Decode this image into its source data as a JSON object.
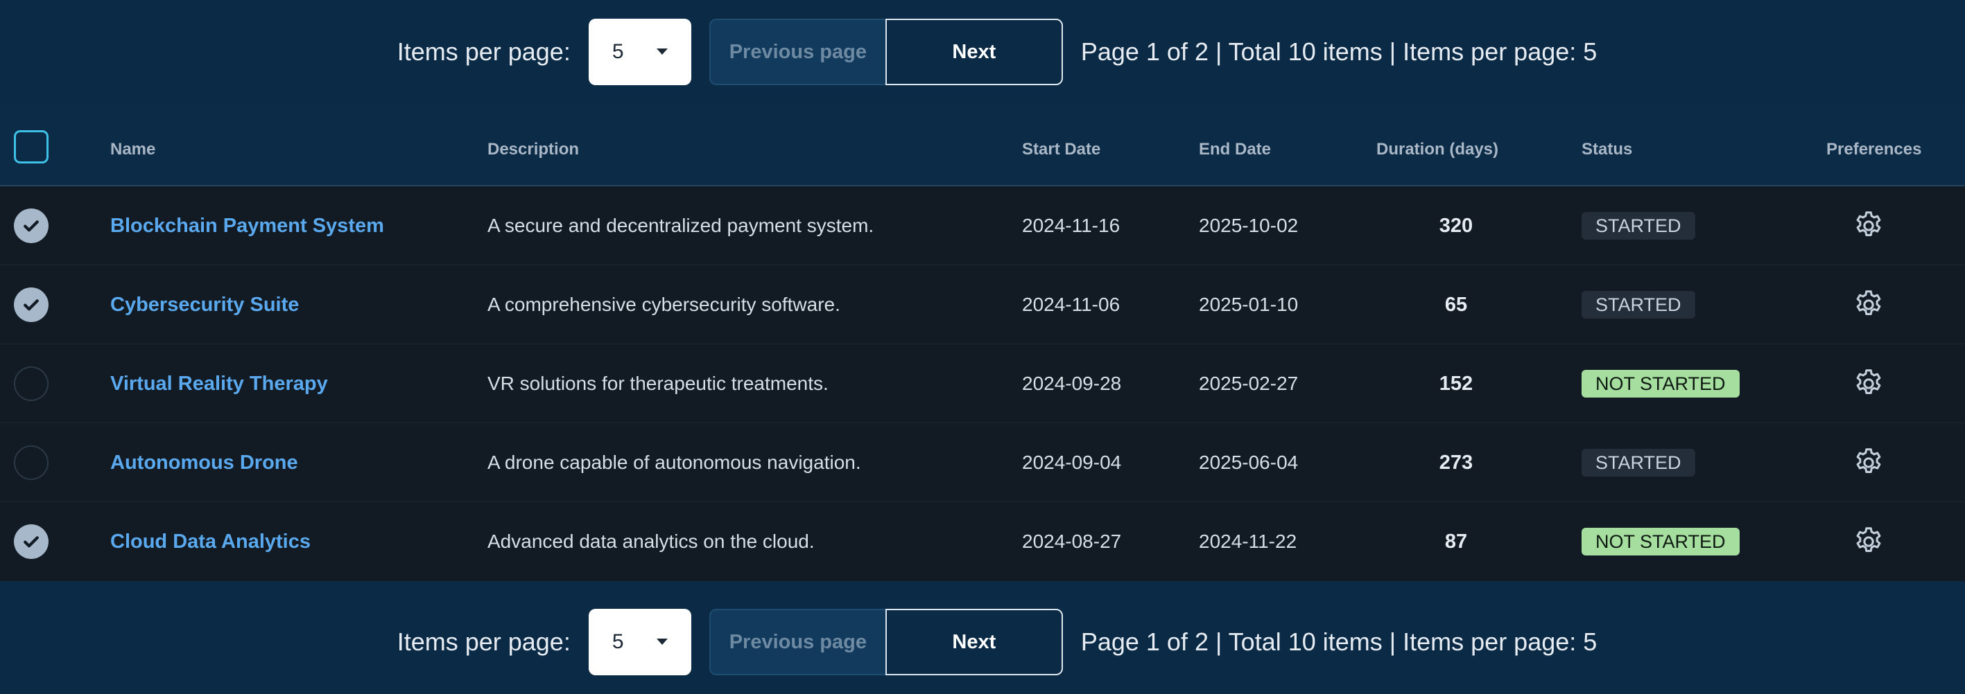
{
  "pager": {
    "items_per_page_label": "Items per page:",
    "selected_page_size": "5",
    "prev_label": "Previous page",
    "next_label": "Next",
    "summary": "Page 1 of 2 | Total 10 items | Items per page: 5"
  },
  "table": {
    "headers": {
      "name": "Name",
      "description": "Description",
      "start_date": "Start Date",
      "end_date": "End Date",
      "duration": "Duration (days)",
      "status": "Status",
      "preferences": "Preferences"
    },
    "rows": [
      {
        "selected": true,
        "name": "Blockchain Payment System",
        "description": "A secure and decentralized payment system.",
        "start": "2024-11-16",
        "end": "2025-10-02",
        "duration": "320",
        "status": "STARTED"
      },
      {
        "selected": true,
        "name": "Cybersecurity Suite",
        "description": "A comprehensive cybersecurity software.",
        "start": "2024-11-06",
        "end": "2025-01-10",
        "duration": "65",
        "status": "STARTED"
      },
      {
        "selected": false,
        "name": "Virtual Reality Therapy",
        "description": "VR solutions for therapeutic treatments.",
        "start": "2024-09-28",
        "end": "2025-02-27",
        "duration": "152",
        "status": "NOT STARTED"
      },
      {
        "selected": false,
        "name": "Autonomous Drone",
        "description": "A drone capable of autonomous navigation.",
        "start": "2024-09-04",
        "end": "2025-06-04",
        "duration": "273",
        "status": "STARTED"
      },
      {
        "selected": true,
        "name": "Cloud Data Analytics",
        "description": "Advanced data analytics on the cloud.",
        "start": "2024-08-27",
        "end": "2024-11-22",
        "duration": "87",
        "status": "NOT STARTED"
      }
    ]
  },
  "icons": {
    "gear": "gear-icon",
    "check": "check-icon",
    "caret": "caret-down-icon"
  },
  "colors": {
    "background": "#0a2a45",
    "row_background": "#121b24",
    "link": "#5aa9ef",
    "not_started_badge": "#a6dea0",
    "started_badge": "#232e3a",
    "header_checkbox_border": "#3fc1e6"
  }
}
